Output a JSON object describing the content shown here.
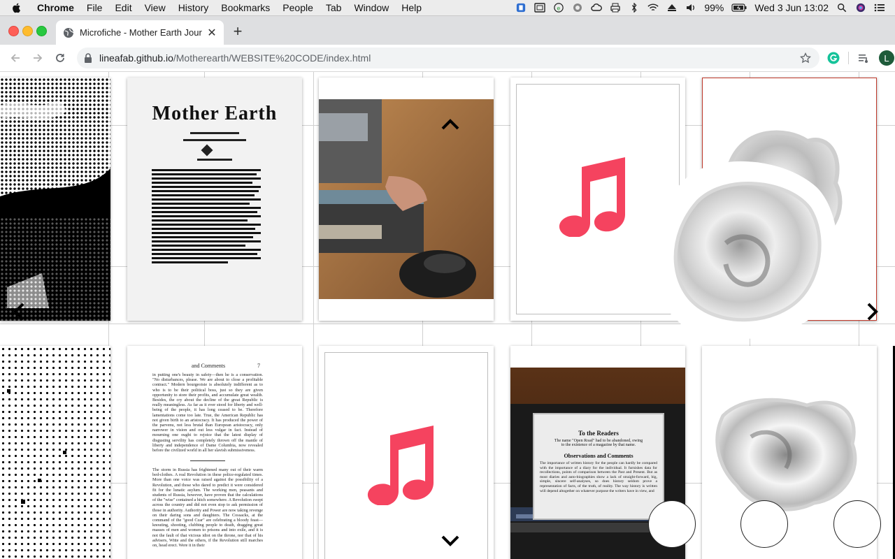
{
  "menubar": {
    "app": "Chrome",
    "items": [
      "File",
      "Edit",
      "View",
      "History",
      "Bookmarks",
      "People",
      "Tab",
      "Window",
      "Help"
    ],
    "battery": "99%",
    "datetime": "Wed 3 Jun  13:02"
  },
  "browser": {
    "tab_title": "Microfiche - Mother Earth Jour",
    "url_host": "lineafab.github.io",
    "url_path": "/Motherearth/WEBSITE%20CODE/index.html"
  },
  "page": {
    "doc_header": "Mother Earth",
    "page_header_left": "and Comments",
    "page_number": "7",
    "page_excerpt_1": "in putting one's beauty in safety—then he is a conservation. \"No disturbances, please. We are about to close a profitable contract.\" Modern bourgeoisie is absolutely indifferent as to who is to be their political boss, just so they are given opportunity to store their profits, and accumulate great wealth. Besides, the cry about the decline of the great Republic is really meaningless. As far as it ever stood for liberty and well-being of the people, it has long ceased to be. Therefore lamentations come too late. True, the American Republic has not given birth to an aristocracy. It has produced the power of the parvenu, not less brutal than European aristocracy, only narrower in vision and out less vulgar in fact. Instead of mourning one ought to rejoice that the latest display of disgusting servility has completely thrown off the mantle of liberty and independence of Dame Columbia, now revealed before the civilized world in all her slavish submissiveness.",
    "page_excerpt_2": "The storm in Russia has frightened many out of their warm bed-clothes. A real Revolution in these police-regulated times. More than one voice was raised against the possibility of a Revolution, and those who dared to predict it were considered fit for the lunatic asylum. The working men, peasants and students of Russia, however, have proven that the calculations of the \"wise\" contained a hitch somewhere. A Revolution swept across the country and did not even stop to ask permission of those in authority. Authority and Power are now taking revenge on their daring sons and daughters. The Cossacks, at the command of the \"good Czar\" are celebrating a bloody feast—knouting, shooting, clubbing people to death, dragging great masses of men and women to prisons and into exile, and it is not the fault of that vicious idiot on the throne, nor that of his advisers, Witte and the others, if the Revolution still marches on, head erect. Were it in their",
    "screen_heading": "To the Readers",
    "screen_line1": "The name \"Open Road\" had to be abandoned, owing",
    "screen_line2": "to the existence of a magazine by that name.",
    "screen_heading2": "Observations and Comments",
    "screen_body": "The importance of written history for the people can hardly be compared with the importance of a diary for the individual. It furnishes data for recollections, points of comparison between the Past and Present. But as most diaries and auto-biographies show a lack of straight-forward, big, simple, sincere self-analyses, so does history seldom prove a representation of facts, of the truth, of reality. The way history is written will depend altogether on whatever purpose the writers have in view, and",
    "icons": {
      "music": "music-note-icon",
      "prev": "chevron-left-icon",
      "next": "chevron-right-icon",
      "up": "chevron-up-icon",
      "down": "chevron-down-icon"
    },
    "colors": {
      "music": "#f5435f",
      "selected_border": "#c0392b"
    }
  }
}
